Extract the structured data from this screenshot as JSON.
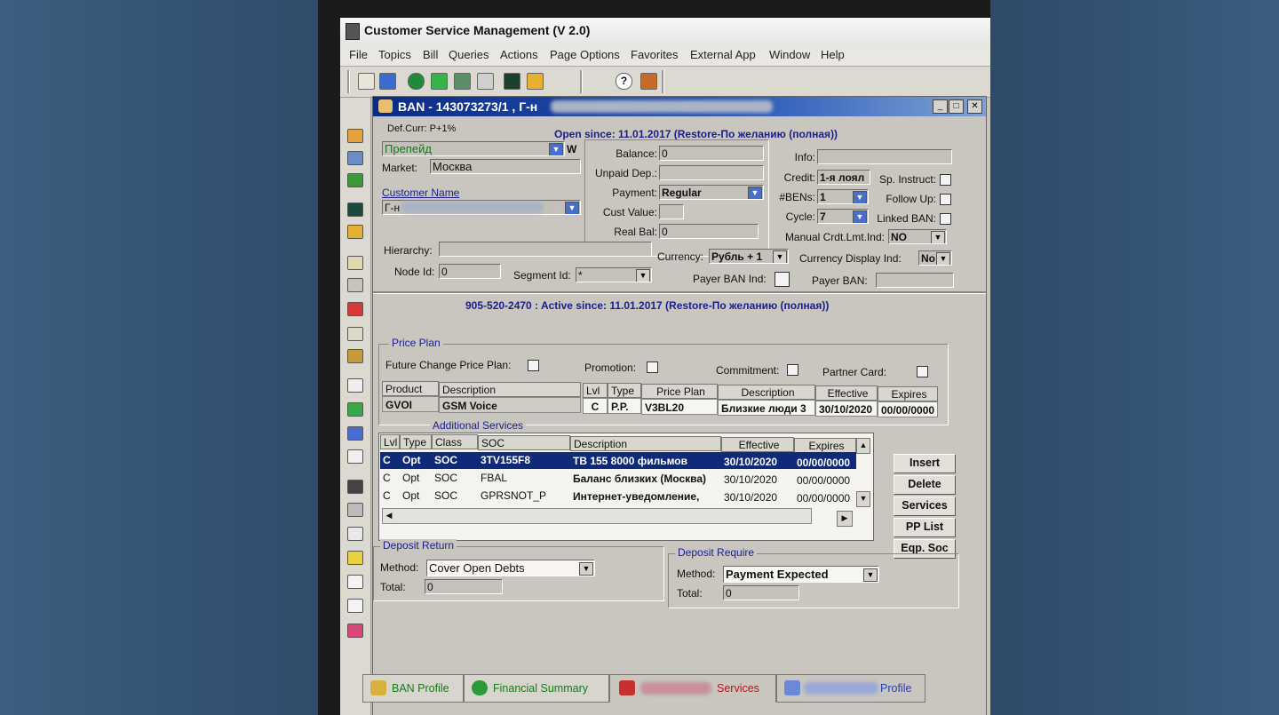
{
  "app": {
    "title": "Customer Service Management  (V 2.0)",
    "menu": [
      "File",
      "Topics",
      "Bill",
      "Queries",
      "Actions",
      "Page Options",
      "Favorites",
      "External App",
      "Window",
      "Help"
    ]
  },
  "window": {
    "title": "BAN - 143073273/1 , Г-н"
  },
  "header": {
    "def_curr": "Def.Curr: P+1%",
    "open_since": "Open since: 11.01.2017 (Restore-По желанию (полная))",
    "account_type": "Препейд",
    "account_type_suffix": "W",
    "market_label": "Market:",
    "market_value": "Москва",
    "customer_name_label": "Customer Name",
    "customer_name_value": "Г-н",
    "balance_label": "Balance:",
    "balance_value": "0",
    "unpaid_label": "Unpaid Dep.:",
    "unpaid_value": "",
    "payment_label": "Payment:",
    "payment_value": "Regular",
    "cust_value_label": "Cust Value:",
    "cust_value": "",
    "real_bal_label": "Real Bal:",
    "real_bal_value": "0",
    "info_label": "Info:",
    "info_value": "",
    "credit_label": "Credit:",
    "credit_value": "1-я лоял",
    "bens_label": "#BENs:",
    "bens_value": "1",
    "cycle_label": "Cycle:",
    "cycle_value": "7",
    "sp_instruct_label": "Sp. Instruct:",
    "follow_up_label": "Follow Up:",
    "linked_ban_label": "Linked BAN:",
    "manual_crdt_label": "Manual Crdt.Lmt.Ind:",
    "manual_crdt_value": "NO",
    "hierarchy_label": "Hierarchy:",
    "hierarchy_value": "",
    "currency_label": "Currency:",
    "currency_value": "Рубль + 1",
    "currency_display_label": "Currency Display Ind:",
    "currency_display_value": "No",
    "node_id_label": "Node Id:",
    "node_id_value": "0",
    "segment_id_label": "Segment Id:",
    "segment_id_value": "*",
    "payer_ban_ind_label": "Payer BAN Ind:",
    "payer_ban_label": "Payer BAN:",
    "payer_ban_value": ""
  },
  "subscriber": {
    "status": "905-520-2470 : Active since: 11.01.2017 (Restore-По желанию (полная))"
  },
  "price_plan": {
    "title": "Price Plan",
    "future_change_label": "Future Change Price Plan:",
    "promotion_label": "Promotion:",
    "commitment_label": "Commitment:",
    "partner_card_label": "Partner Card:",
    "columns": [
      "Product",
      "Description",
      "Lvl",
      "Type",
      "Price Plan",
      "Description",
      "Effective",
      "Expires"
    ],
    "row": {
      "product": "GVOI",
      "product_desc": "GSM Voice",
      "lvl": "C",
      "type": "P.P.",
      "price_plan": "V3BL20",
      "plan_desc": "Близкие люди 3",
      "effective": "30/10/2020",
      "expires": "00/00/0000"
    }
  },
  "additional_services": {
    "title": "Additional Services",
    "columns": [
      "Lvl",
      "Type",
      "Class",
      "SOC",
      "Description",
      "Effective",
      "Expires"
    ],
    "rows": [
      {
        "lvl": "C",
        "type": "Opt",
        "class": "SOC",
        "soc": "3TV155F8",
        "description": "ТВ 155 8000 фильмов",
        "effective": "30/10/2020",
        "expires": "00/00/0000"
      },
      {
        "lvl": "C",
        "type": "Opt",
        "class": "SOC",
        "soc": "FBAL",
        "description": "Баланс близких (Москва)",
        "effective": "30/10/2020",
        "expires": "00/00/0000"
      },
      {
        "lvl": "C",
        "type": "Opt",
        "class": "SOC",
        "soc": "GPRSNOT_P",
        "description": "Интернет-уведомление,",
        "effective": "30/10/2020",
        "expires": "00/00/0000"
      }
    ],
    "buttons": [
      "Insert",
      "Delete",
      "Services",
      "PP List",
      "Eqp. Soc"
    ]
  },
  "deposit_return": {
    "title": "Deposit Return",
    "method_label": "Method:",
    "method_value": "Cover Open Debts",
    "total_label": "Total:",
    "total_value": "0"
  },
  "deposit_require": {
    "title": "Deposit Require",
    "method_label": "Method:",
    "method_value": "Payment Expected",
    "total_label": "Total:",
    "total_value": "0"
  },
  "tabs": [
    "BAN Profile",
    "Financial Summary",
    "Services",
    "Profile"
  ]
}
